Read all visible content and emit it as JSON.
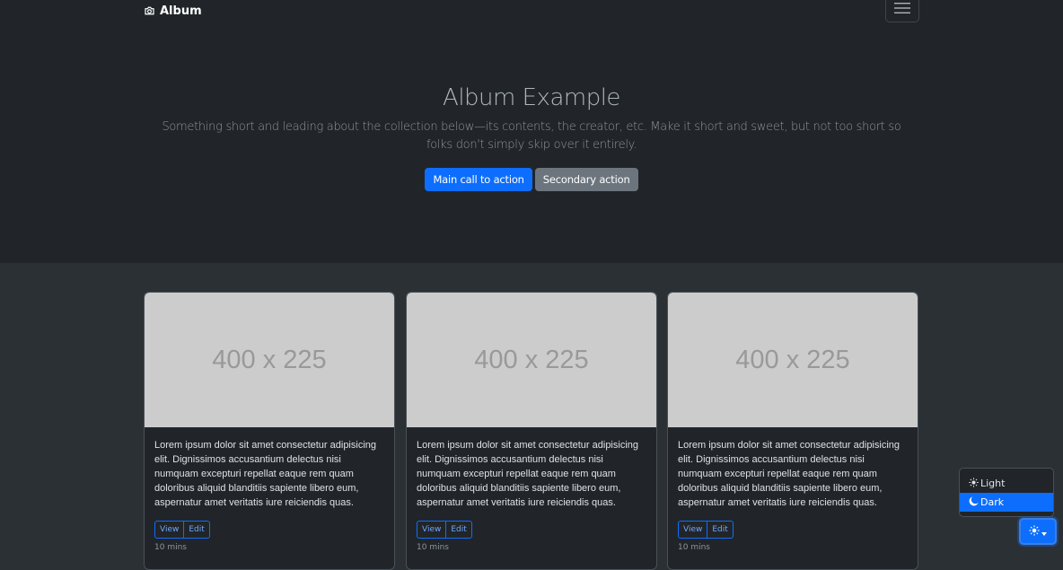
{
  "navbar": {
    "brand": "Album",
    "brand_icon": "camera-icon",
    "toggler_icon": "hamburger-icon"
  },
  "hero": {
    "title": "Album Example",
    "lead": "Something short and leading about the collection below—its contents, the creator, etc. Make it short and sweet, but not too short so folks don't simply skip over it entirely.",
    "primary_action": "Main call to action",
    "secondary_action": "Secondary action"
  },
  "cards": [
    {
      "thumbnail": "400 x 225",
      "text": "Lorem ipsum dolor sit amet consectetur adipisicing elit. Dignissimos accusantium delectus nisi numquam excepturi repellat eaque rem quam doloribus aliquid blanditiis sapiente libero eum, aspernatur amet veritatis iure reiciendis quas.",
      "view": "View",
      "edit": "Edit",
      "time": "10 mins"
    },
    {
      "thumbnail": "400 x 225",
      "text": "Lorem ipsum dolor sit amet consectetur adipisicing elit. Dignissimos accusantium delectus nisi numquam excepturi repellat eaque rem quam doloribus aliquid blanditiis sapiente libero eum, aspernatur amet veritatis iure reiciendis quas.",
      "view": "View",
      "edit": "Edit",
      "time": "10 mins"
    },
    {
      "thumbnail": "400 x 225",
      "text": "Lorem ipsum dolor sit amet consectetur adipisicing elit. Dignissimos accusantium delectus nisi numquam excepturi repellat eaque rem quam doloribus aliquid blanditiis sapiente libero eum, aspernatur amet veritatis iure reiciendis quas.",
      "view": "View",
      "edit": "Edit",
      "time": "10 mins"
    }
  ],
  "theme_menu": {
    "items": [
      {
        "label": "Light",
        "icon": "sun-icon",
        "active": false
      },
      {
        "label": "Dark",
        "icon": "moon-icon",
        "active": true
      }
    ],
    "toggle_icon": "sun-icon"
  },
  "colors": {
    "primary": "#0d6efd",
    "secondary": "#6c757d",
    "background_dark": "#212529",
    "background_body": "#2b3035",
    "placeholder": "#cccccc"
  }
}
